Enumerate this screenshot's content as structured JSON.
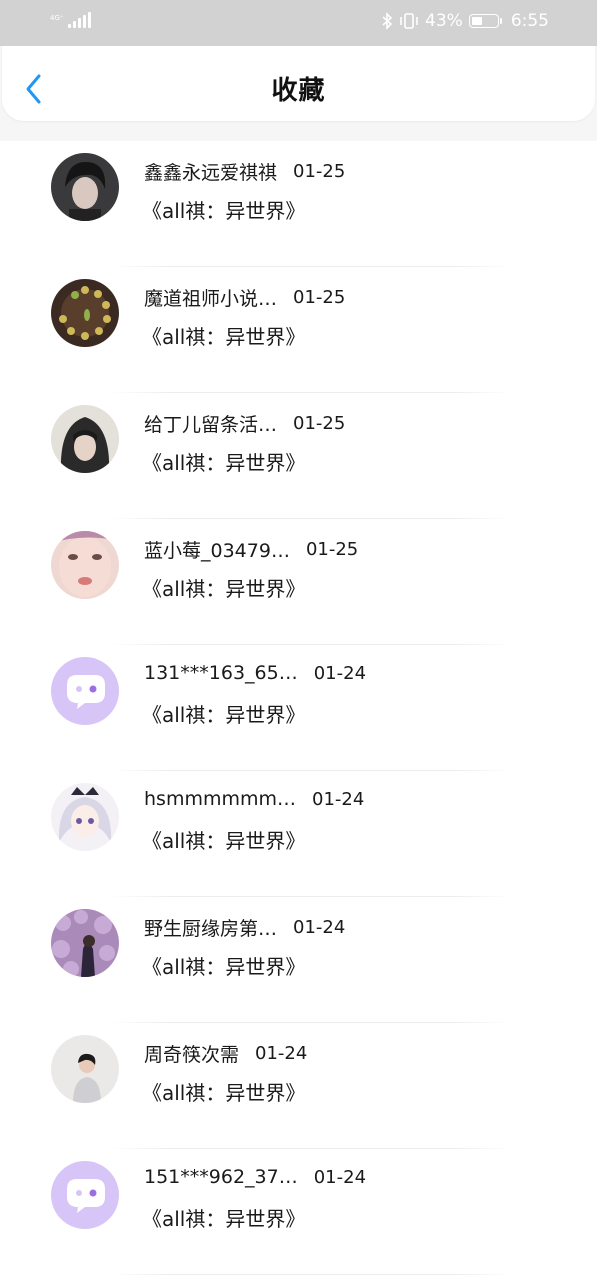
{
  "status_bar": {
    "network": "4G⁺",
    "battery_pct": "43%",
    "battery_level": 0.43,
    "time": "6:55"
  },
  "header": {
    "title": "收藏",
    "back_icon": "chevron-left-icon",
    "accent_color": "#2196f3"
  },
  "favorites": [
    {
      "name": "鑫鑫永远爱祺祺",
      "date": "01-25",
      "title": "《all祺：异世界》",
      "avatar": "photo-dark-hair"
    },
    {
      "name": "魔道祖师小说…",
      "date": "01-25",
      "title": "《all祺：异世界》",
      "avatar": "photo-succulent"
    },
    {
      "name": "给丁儿留条活…",
      "date": "01-25",
      "title": "《all祺：异世界》",
      "avatar": "photo-hood"
    },
    {
      "name": "蓝小莓_03479…",
      "date": "01-25",
      "title": "《all祺：异世界》",
      "avatar": "photo-face"
    },
    {
      "name": "131***163_65…",
      "date": "01-24",
      "title": "《all祺：异世界》",
      "avatar": "default-chat-avatar"
    },
    {
      "name": "hsmmmmmm…",
      "date": "01-24",
      "title": "《all祺：异世界》",
      "avatar": "anime-girl"
    },
    {
      "name": "野生厨缘房第…",
      "date": "01-24",
      "title": "《all祺：异世界》",
      "avatar": "photo-flowers"
    },
    {
      "name": "周奇筷次需",
      "date": "01-24",
      "title": "《all祺：异世界》",
      "avatar": "photo-person-white"
    },
    {
      "name": "151***962_37…",
      "date": "01-24",
      "title": "《all祺：异世界》",
      "avatar": "default-chat-avatar"
    }
  ]
}
